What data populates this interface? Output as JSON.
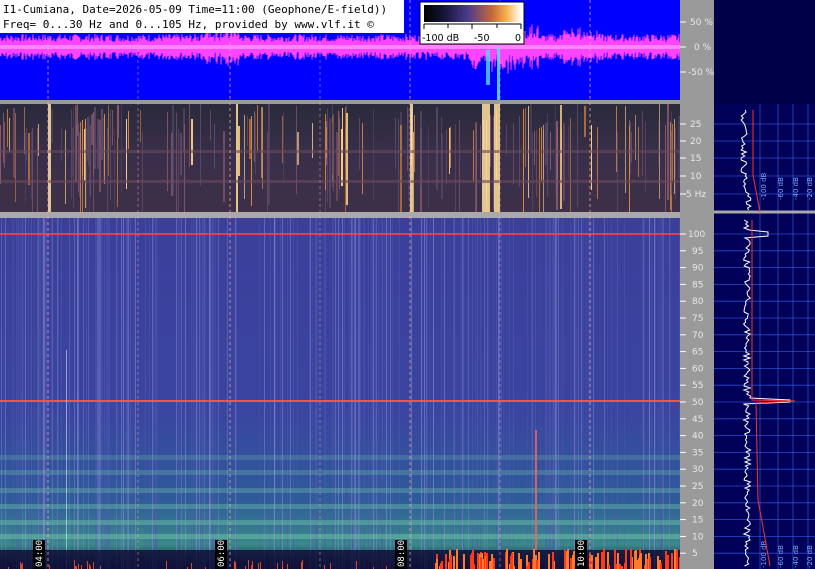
{
  "header": {
    "line1": "I1-Cumiana, Date=2026-05-09 Time=11:00 (Geophone/E-field))",
    "line2": "Freq= 0...30 Hz and 0...105 Hz, provided by www.vlf.it ©"
  },
  "colorbar": {
    "min_label": "-100 dB",
    "mid_label": "-50",
    "max_label": "0",
    "colors": [
      "#000000",
      "#2a2a6e",
      "#5e4aa0",
      "#c56a3a",
      "#f7b24a",
      "#ffffff"
    ]
  },
  "waveform": {
    "tick_labels": [
      "50 %",
      "0 %",
      "-50 %"
    ],
    "background_color": "#0000ff",
    "trace_color": "#ff44ff"
  },
  "spectrogram_low": {
    "tick_labels": [
      "25",
      "20",
      "15",
      "10",
      "5 Hz"
    ]
  },
  "spectrogram_high": {
    "tick_labels": [
      "100",
      "95",
      "90",
      "85",
      "80",
      "75",
      "70",
      "65",
      "60",
      "55",
      "50",
      "45",
      "40",
      "35",
      "30",
      "25",
      "20",
      "15",
      "10",
      "5"
    ],
    "hum_line_labels": [
      "100",
      "50"
    ]
  },
  "time_labels": [
    "04:00",
    "06:00",
    "08:00",
    "10:00"
  ],
  "side_panel": {
    "scale_labels_low": [
      "-100 dB",
      "-60 dB",
      "-40 dB",
      "-20 dB"
    ],
    "scale_labels_high": [
      "-100 dB",
      "-60 dB",
      "-40 dB",
      "-20 dB"
    ]
  }
}
